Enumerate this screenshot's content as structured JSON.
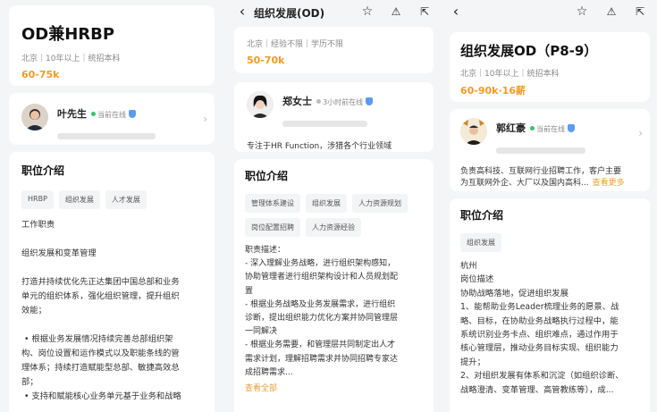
{
  "panel1": {
    "job_title": "OD兼HRBP",
    "meta": "北京｜10年以上｜统招本科",
    "salary": "60-75k",
    "recruiter": {
      "name": "叶先生",
      "status": "当前在线"
    },
    "section_title": "职位介绍",
    "tags": [
      "HRBP",
      "组织发展",
      "人才发展"
    ],
    "description": "工作职责\n\n组织发展和变革管理\n\n打造并持续优化先正达集团中国总部和业务\n单元的组织体系，强化组织管理，提升组织\n效能；\n\n • 根据业务发展情况持续完善总部组织架\n构、岗位设置和运作模式以及职能条线的管\n理体系；持续打造赋能型总部、敏捷高效总\n部；\n • 支持和赋能核心业务单元基于业务和战略"
  },
  "panel2": {
    "header_title": "组织发展(OD)",
    "meta": "北京｜经验不限｜学历不限",
    "salary": "50-70k",
    "recruiter": {
      "name": "郑女士",
      "status": "3小时前在线",
      "bio": "专注于HR Function，涉猎各个行业领域"
    },
    "section_title": "职位介绍",
    "tags": [
      "管理体系建设",
      "组织发展",
      "人力资源规划",
      "岗位配置招聘",
      "人力资源经验"
    ],
    "description": "职责描述：\n- 深入理解业务战略，进行组织架构感知，\n协助管理者进行组织架构设计和人员规划配\n置\n- 根据业务战略及业务发展需求，进行组织\n诊断，提出组织能力优化方案并协同管理层\n一同解决\n- 根据业务需要，和管理层共同制定出人才\n需求计划，理解招聘需求并协同招聘专家达\n成招聘需求...",
    "view_all": "查看全部"
  },
  "panel3": {
    "job_title": "组织发展OD（P8-9）",
    "meta": "北京｜10年以上｜统招本科",
    "salary": "60-90k·16薪",
    "recruiter": {
      "name": "郭红豪",
      "status": "当前在线",
      "bio": "负责高科技、互联网行业招聘工作，客户主要\n为互联网外企、大厂以及国内高科...",
      "view_more": "查看更多"
    },
    "section_title": "职位介绍",
    "tags": [
      "组织发展"
    ],
    "description": "杭州\n岗位描述\n协助战略落地，促进组织发展\n1、能帮助业务Leader梳理业务的愿景、战\n略、目标，在协助业务战略执行过程中，能\n系统识别业务卡点、组织难点，通过作用于\n核心管理层，推动业务目标实现、组织能力\n提升；\n2、对组织发展有体系和沉淀（如组织诊断、\n战略澄清、变革管理、高管教练等），成..."
  },
  "icons": [
    "back-icon",
    "star-icon",
    "warning-icon",
    "share-icon",
    "chevron-right-icon",
    "verified-shield-icon"
  ],
  "colors": {
    "salary": "#f29a28",
    "online": "#33c46a",
    "link": "#e5a03a",
    "verified": "#5b9cf0"
  }
}
